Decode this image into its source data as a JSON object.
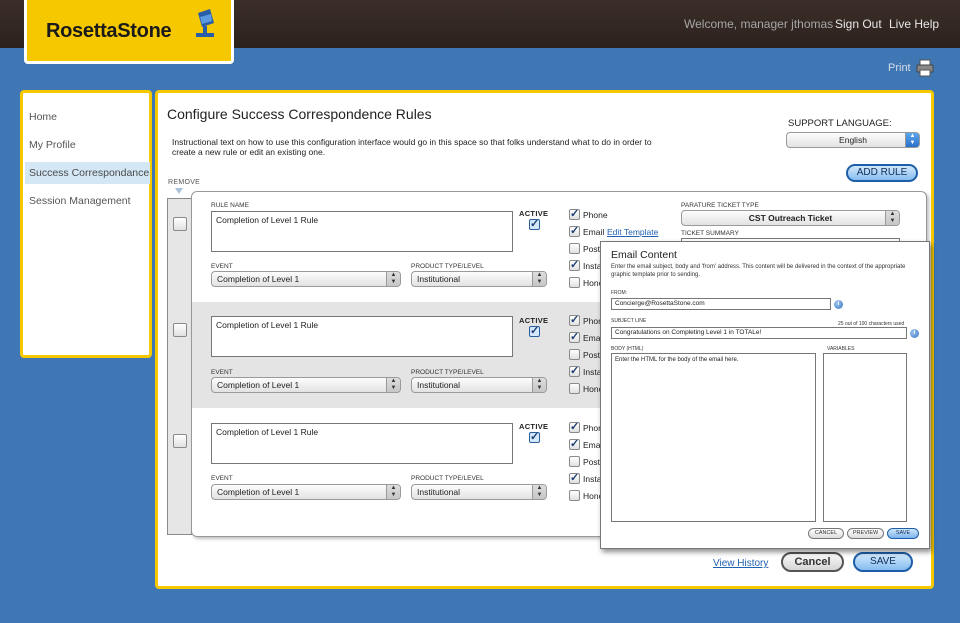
{
  "brand": {
    "logo_text": "RosettaStone",
    "accent": "#f5c800",
    "background": "#3f77b5"
  },
  "header": {
    "welcome": "Welcome,  manager jthomas",
    "sign_out": "Sign Out",
    "live_help": "Live Help"
  },
  "toolbar": {
    "print": "Print"
  },
  "sidebar": {
    "items": [
      {
        "label": "Home",
        "active": false
      },
      {
        "label": "My Profile",
        "active": false
      },
      {
        "label": "Success Correspondance",
        "active": true
      },
      {
        "label": "Session Management",
        "active": false
      }
    ]
  },
  "page": {
    "title": "Configure Success Correspondence Rules",
    "instructions": "Instructional text on how to use this configuration interface would go in this space so that folks understand what to do in order to create a new rule or edit an existing one.",
    "support_language_label": "SUPPORT LANGUAGE:",
    "support_language_value": "English",
    "add_rule": "ADD RULE",
    "remove_label": "REMOVE"
  },
  "labels": {
    "rule_name": "RULE  NAME",
    "event": "EVENT",
    "product_type": "PRODUCT TYPE/LEVEL",
    "active": "ACTIVE",
    "parature_type": "PARATURE TICKET TYPE",
    "ticket_summary": "TICKET SUMMARY"
  },
  "rules": [
    {
      "name": "Completion of Level 1 Rule",
      "event": "Completion of Level 1",
      "product": "Institutional",
      "active": true,
      "channels": [
        "Phone",
        "Email",
        "Postal",
        "Instant",
        "Honor"
      ],
      "edit_template": "Edit Template",
      "parature_ticket_type": "CST Outreach Ticket"
    },
    {
      "name": "Completion of Level 1 Rule",
      "event": "Completion of Level 1",
      "product": "Institutional",
      "active": true,
      "channels": [
        "Phone",
        "Email",
        "Postal",
        "Instan",
        "Honor"
      ]
    },
    {
      "name": "Completion of Level 1 Rule",
      "event": "Completion of Level 1",
      "product": "Institutional",
      "active": true,
      "channels": [
        "Phone",
        "Email",
        "Postal",
        "Instan",
        "Honor"
      ]
    }
  ],
  "email_modal": {
    "title": "Email Content",
    "description": "Enter the email subject, body and 'from' address.  This content will be delivered in the context of the appropriate graphic template prior to sending.",
    "from_label": "FROM:",
    "from_value": "Concierge@RosettaStone.com",
    "subject_label": "SUBJECT LINE",
    "char_count": "25 out of 100 characters used",
    "subject_value": "Congratulations on Completing Level 1 in TOTALe!",
    "body_label": "BODY (HTML)",
    "body_placeholder": "Enter the HTML for the body of the email here.",
    "variables_label": "VARIABLES",
    "cancel": "CANCEL",
    "preview": "PREVIEW",
    "save": "SAVE"
  },
  "footer": {
    "view_history": "View History",
    "cancel": "Cancel",
    "save": "SAVE"
  }
}
